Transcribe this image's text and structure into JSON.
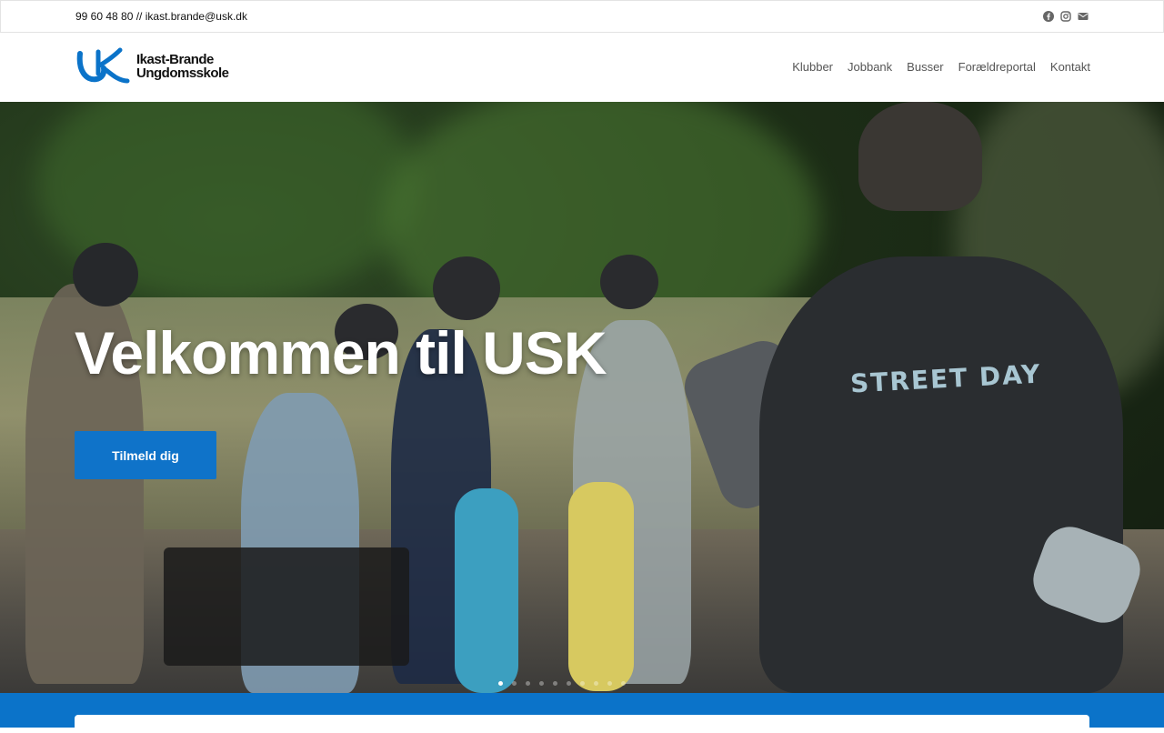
{
  "topbar": {
    "contact": "99 60 48 80 // ikast.brande@usk.dk",
    "social_icons": [
      "facebook-icon",
      "instagram-icon",
      "envelope-icon"
    ]
  },
  "header": {
    "logo_line1": "Ikast-Brande",
    "logo_line2": "Ungdomsskole",
    "nav": [
      "Klubber",
      "Jobbank",
      "Busser",
      "Forældreportal",
      "Kontakt"
    ]
  },
  "hero": {
    "title": "Velkommen til USK",
    "cta_label": "Tilmeld dig",
    "shirt_text": "STREET DAY",
    "slide_count": 10,
    "active_slide": 1
  },
  "colors": {
    "brand_blue": "#0b73c9",
    "button_blue": "#0f73c9"
  }
}
